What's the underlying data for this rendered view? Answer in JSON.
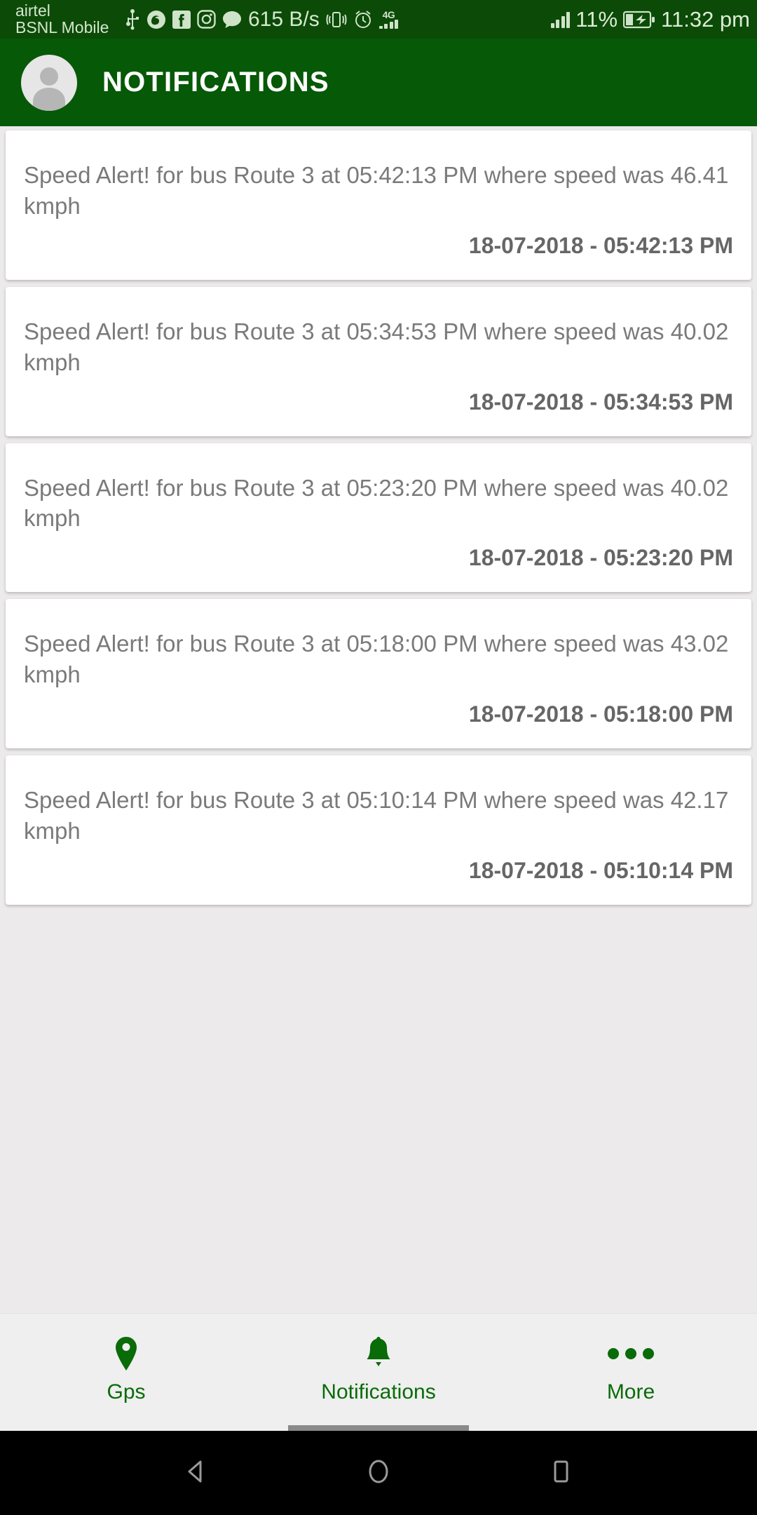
{
  "status_bar": {
    "carrier_line1": "airtel",
    "carrier_line2": "BSNL Mobile",
    "network_speed": "615 B/s",
    "network_type": "4G",
    "battery_percent": "11%",
    "clock": "11:32 pm",
    "icons": [
      "usb-icon",
      "firefox-icon",
      "facebook-icon",
      "instagram-icon",
      "chat-bubble-icon",
      "vibrate-icon",
      "alarm-clock-icon",
      "signal-bars-icon",
      "signal-bars-icon",
      "battery-charging-icon"
    ]
  },
  "app_bar": {
    "title": "NOTIFICATIONS",
    "avatar_icon": "person-avatar-icon",
    "background_color": "#065907"
  },
  "notifications": [
    {
      "message": "Speed Alert! for bus Route 3 at 05:42:13 PM where speed was 46.41 kmph",
      "timestamp": "18-07-2018 - 05:42:13 PM"
    },
    {
      "message": "Speed Alert! for bus Route 3 at 05:34:53 PM where speed was 40.02 kmph",
      "timestamp": "18-07-2018 - 05:34:53 PM"
    },
    {
      "message": "Speed Alert! for bus Route 3 at 05:23:20 PM where speed was 40.02 kmph",
      "timestamp": "18-07-2018 - 05:23:20 PM"
    },
    {
      "message": "Speed Alert! for bus Route 3 at 05:18:00 PM where speed was 43.02 kmph",
      "timestamp": "18-07-2018 - 05:18:00 PM"
    },
    {
      "message": "Speed Alert! for bus Route 3 at 05:10:14 PM where speed was 42.17 kmph",
      "timestamp": "18-07-2018 - 05:10:14 PM"
    }
  ],
  "bottom_nav": {
    "accent_color": "#0a6b09",
    "items": [
      {
        "label": "Gps",
        "icon": "map-pin-icon"
      },
      {
        "label": "Notifications",
        "icon": "bell-icon"
      },
      {
        "label": "More",
        "icon": "more-dots-icon"
      }
    ]
  },
  "android_nav": {
    "back_icon": "back-triangle-icon",
    "home_icon": "home-circle-icon",
    "recents_icon": "recents-square-icon"
  }
}
